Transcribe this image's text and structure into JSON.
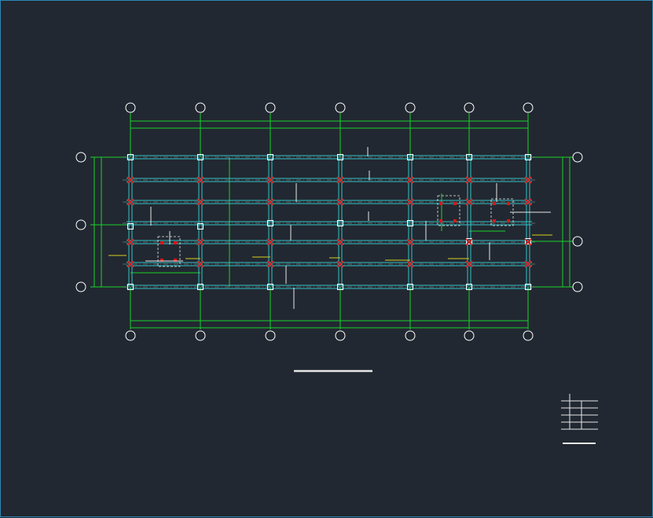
{
  "app": {
    "viewport": "cad-model-space",
    "drawing": "structural-framing-plan"
  },
  "colors": {
    "background": "#222831",
    "frame": "#2e86b5",
    "beam": "#31c4c6",
    "dimension": "#18d22a",
    "axis_bubble": "#ffffff",
    "column": "#ffffff",
    "rebar_mark": "#e01515",
    "annotation": "#d8d020",
    "leader": "#e6e6e6"
  },
  "axis_bubbles": {
    "top_count": 7,
    "bottom_count": 7,
    "left_count": 3,
    "right_count": 3,
    "labels": []
  },
  "title_block": {
    "title_text": "",
    "legend_text": ""
  }
}
